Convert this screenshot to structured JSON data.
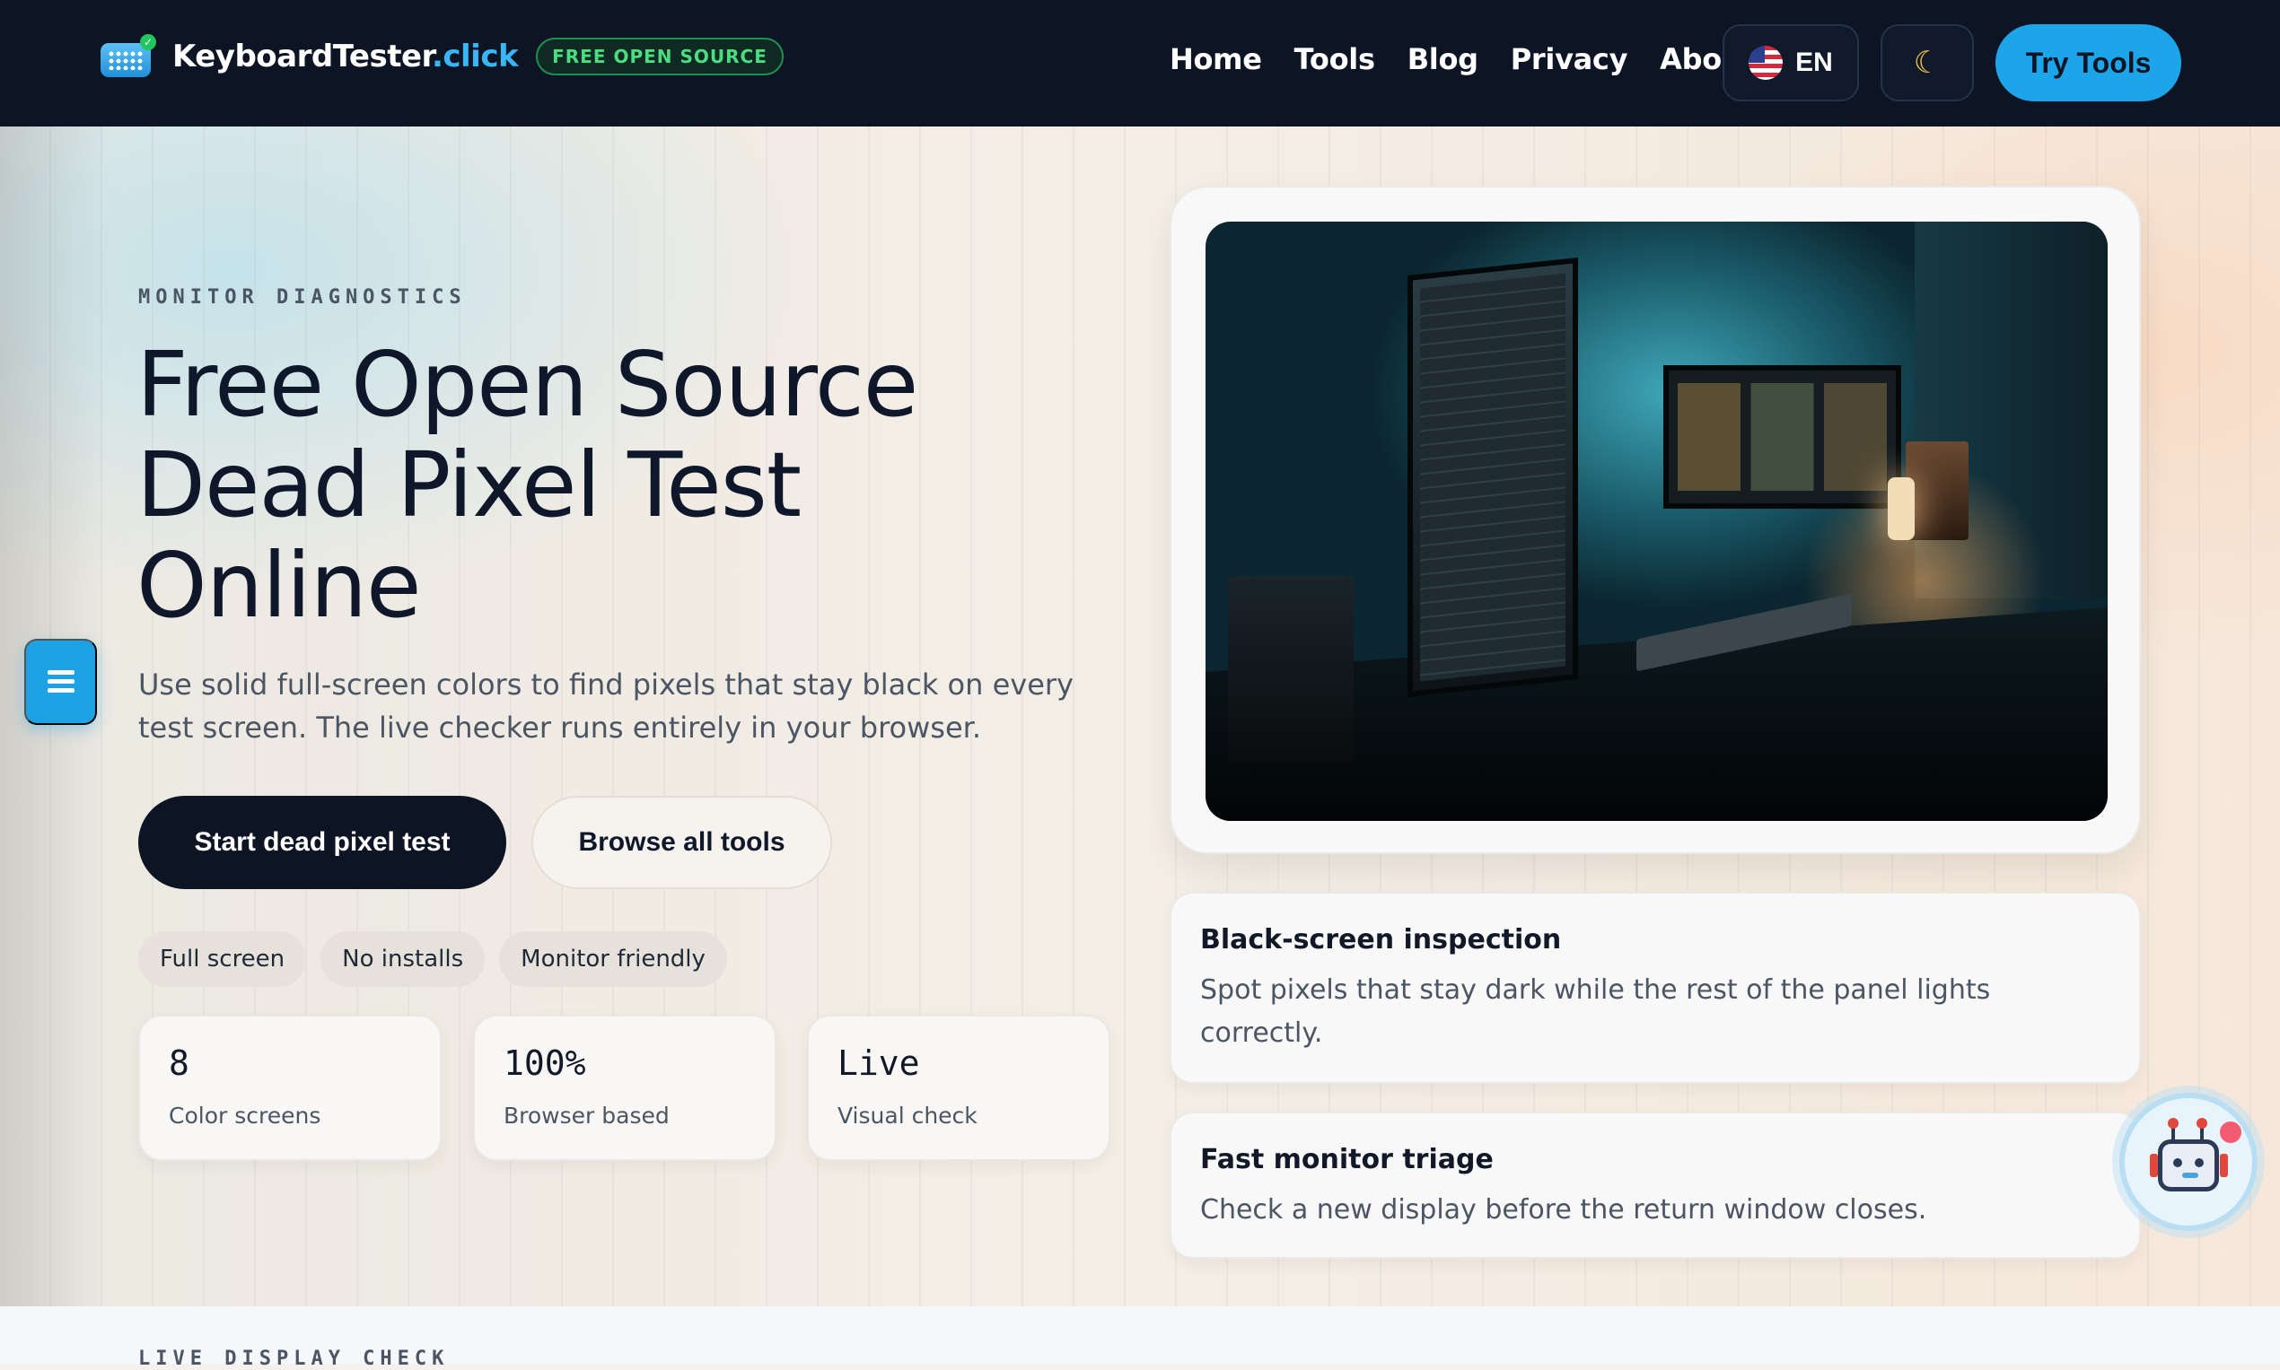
{
  "nav": {
    "brand_main": "KeyboardTester",
    "brand_tld": ".click",
    "badge": "FREE OPEN SOURCE",
    "links": [
      "Home",
      "Tools",
      "Blog",
      "Privacy",
      "About"
    ],
    "lang": "EN",
    "theme_icon": "☾",
    "cta": "Try Tools"
  },
  "hero": {
    "eyebrow": "MONITOR DIAGNOSTICS",
    "title_lines": [
      "Free Open Source",
      "Dead Pixel Test",
      "Online"
    ],
    "subtitle": "Use solid full-screen colors to find pixels that stay black on every test screen. The live checker runs entirely in your browser.",
    "primary_button": "Start dead pixel test",
    "secondary_button": "Browse all tools",
    "chips": [
      "Full screen",
      "No installs",
      "Monitor friendly"
    ],
    "stats": [
      {
        "value": "8",
        "label": "Color screens"
      },
      {
        "value": "100%",
        "label": "Browser based"
      },
      {
        "value": "Live",
        "label": "Visual check"
      }
    ]
  },
  "cards": [
    {
      "title": "Black-screen inspection",
      "text": "Spot pixels that stay dark while the rest of the panel lights correctly."
    },
    {
      "title": "Fast monitor triage",
      "text": "Check a new display before the return window closes."
    }
  ],
  "next_section": {
    "eyebrow": "LIVE DISPLAY CHECK"
  },
  "icons": {
    "brand": "keyboard-icon",
    "flag": "us-flag-icon",
    "theme": "moon-icon",
    "side_menu": "menu-icon",
    "assistant": "robot-icon"
  },
  "colors": {
    "nav_bg": "#0d1525",
    "accent": "#1da5ea",
    "badge_green": "#4ade80",
    "text_dark": "#0f172a"
  }
}
